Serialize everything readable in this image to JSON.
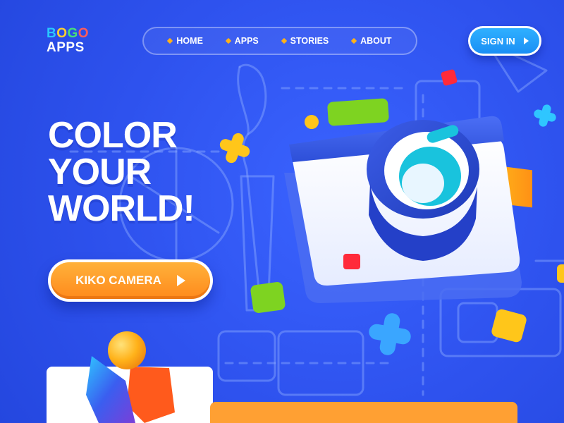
{
  "logo": {
    "letters_row1": [
      "B",
      "O",
      "G",
      "O"
    ],
    "row2": "APPS"
  },
  "nav": {
    "items": [
      {
        "label": "HOME"
      },
      {
        "label": "APPS"
      },
      {
        "label": "STORIES"
      },
      {
        "label": "ABOUT"
      }
    ]
  },
  "signin": {
    "label": "SIGN IN"
  },
  "hero": {
    "lines": [
      "COLOR",
      "YOUR",
      "WORLD!"
    ]
  },
  "cta": {
    "label": "KIKO CAMERA"
  },
  "colors": {
    "background": "#2f55f0",
    "accent_orange": "#ff9a2a",
    "accent_blue": "#1a8ff5",
    "green": "#7ed321",
    "yellow": "#ffc61a",
    "red": "#ff2a3a",
    "cyan": "#00c8e0"
  },
  "icons": [
    "camera-illustration",
    "paint-brush-icon",
    "cross-shape",
    "play-triangle-icon",
    "person-3d-icon"
  ]
}
